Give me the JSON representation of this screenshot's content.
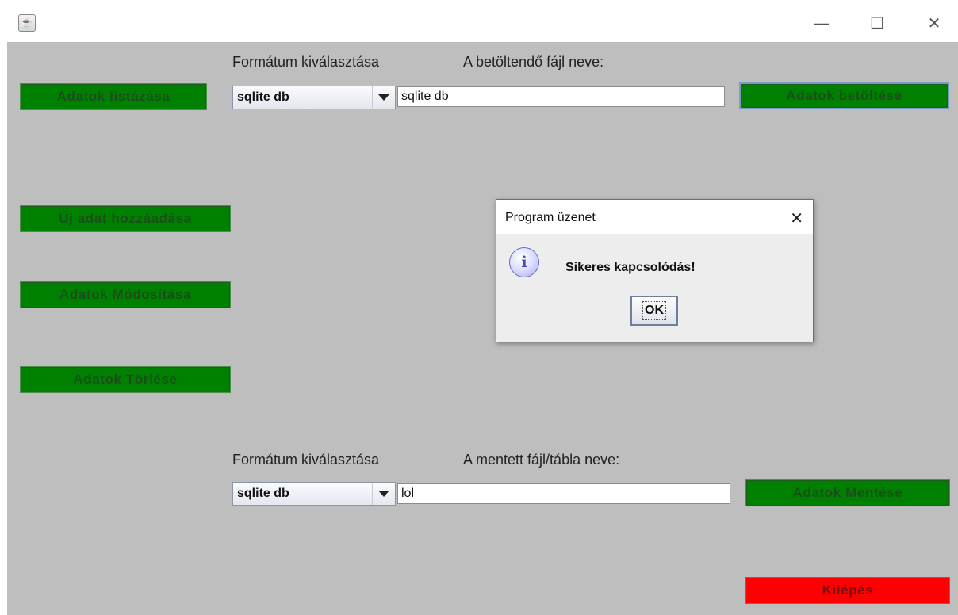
{
  "window": {
    "minimize_glyph": "—",
    "maximize_glyph": "☐",
    "close_glyph": "✕"
  },
  "left_buttons": {
    "list": "Adatok listázása",
    "add": "Új adat hozzáadása",
    "modify": "Adatok Módosítása",
    "delete": "Adatok Törlése"
  },
  "load": {
    "format_label": "Formátum kiválasztása",
    "file_label": "A betöltendő fájl neve:",
    "format_selected": "sqlite db",
    "file_value": "sqlite db",
    "button": "Adatok betöltése"
  },
  "save": {
    "format_label": "Formátum kiválasztása",
    "file_label": "A mentett fájl/tábla neve:",
    "format_selected": "sqlite db",
    "file_value": "lol",
    "button": "Adatok Mentése"
  },
  "exit_button": "Kilépés",
  "dialog": {
    "title": "Program üzenet",
    "close_glyph": "✕",
    "icon_glyph": "i",
    "message": "Sikeres kapcsolódás!",
    "ok": "OK"
  },
  "colors": {
    "action_green": "#008000",
    "exit_red": "#ff0000",
    "frame_gray": "#bebebe"
  },
  "icons": [
    "java-app-icon",
    "minimize-icon",
    "maximize-icon",
    "close-icon",
    "dropdown-arrow-icon",
    "info-icon"
  ]
}
